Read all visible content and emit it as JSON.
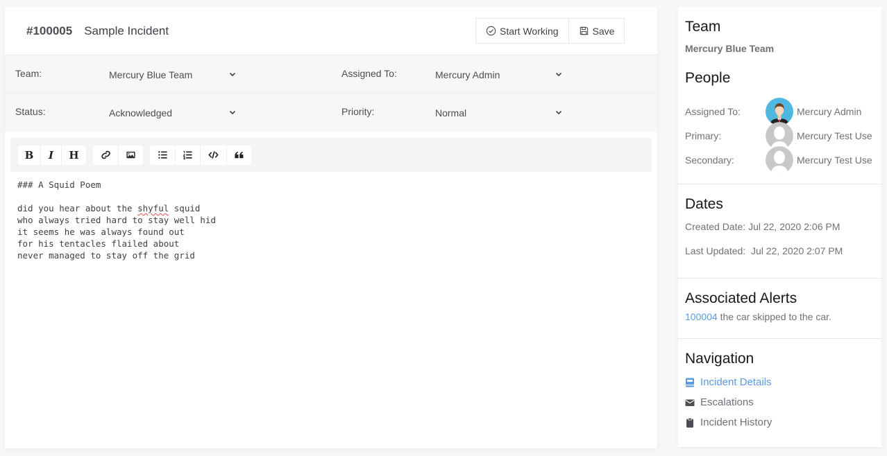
{
  "incident": {
    "number": "#100005",
    "title": "Sample Incident"
  },
  "actions": {
    "start_working": "Start Working",
    "save": "Save"
  },
  "fields": {
    "team": {
      "label": "Team:",
      "value": "Mercury Blue Team"
    },
    "assigned_to": {
      "label": "Assigned To:",
      "value": "Mercury Admin"
    },
    "status": {
      "label": "Status:",
      "value": "Acknowledged"
    },
    "priority": {
      "label": "Priority:",
      "value": "Normal"
    }
  },
  "editor": {
    "toolbar": [
      {
        "name": "bold",
        "label": "B"
      },
      {
        "name": "italic",
        "label": "I"
      },
      {
        "name": "heading",
        "label": "H"
      },
      {
        "name": "link",
        "icon": "link-icon"
      },
      {
        "name": "image",
        "icon": "image-icon"
      },
      {
        "name": "unordered-list",
        "icon": "unordered-list-icon"
      },
      {
        "name": "ordered-list",
        "icon": "ordered-list-icon"
      },
      {
        "name": "code",
        "icon": "code-icon"
      },
      {
        "name": "quote",
        "icon": "quote-icon"
      }
    ],
    "lines": [
      "### A Squid Poem",
      "",
      "did you hear about the ",
      "shyful",
      " squid",
      "who always tried hard to stay well hid",
      "it seems he was always found out",
      "for his tentacles flailed about",
      "never managed to stay off the grid"
    ]
  },
  "sidebar": {
    "team": {
      "heading": "Team",
      "value": "Mercury Blue Team"
    },
    "people": {
      "heading": "People",
      "rows": [
        {
          "label": "Assigned To:",
          "name": "Mercury Admin",
          "avatar": "admin-avatar"
        },
        {
          "label": "Primary:",
          "name": "Mercury Test Use",
          "avatar": "default-avatar"
        },
        {
          "label": "Secondary:",
          "name": "Mercury Test Use",
          "avatar": "default-avatar"
        }
      ]
    },
    "dates": {
      "heading": "Dates",
      "created_label": "Created Date:",
      "created_value": "Jul 22, 2020 2:06 PM",
      "updated_label": "Last Updated:",
      "updated_value": "Jul 22, 2020 2:07 PM"
    },
    "alerts": {
      "heading": "Associated Alerts",
      "items": [
        {
          "id": "100004",
          "text": "the car skipped to the car."
        }
      ]
    },
    "navigation": {
      "heading": "Navigation",
      "items": [
        {
          "label": "Incident Details",
          "icon": "book-icon",
          "active": true
        },
        {
          "label": "Escalations",
          "icon": "envelope-icon",
          "active": false
        },
        {
          "label": "Incident History",
          "icon": "clipboard-icon",
          "active": false
        }
      ]
    }
  },
  "colors": {
    "link": "#5b9be3",
    "avatar_bg": "#4fb8e0",
    "default_avatar": "#c8c8c8"
  }
}
